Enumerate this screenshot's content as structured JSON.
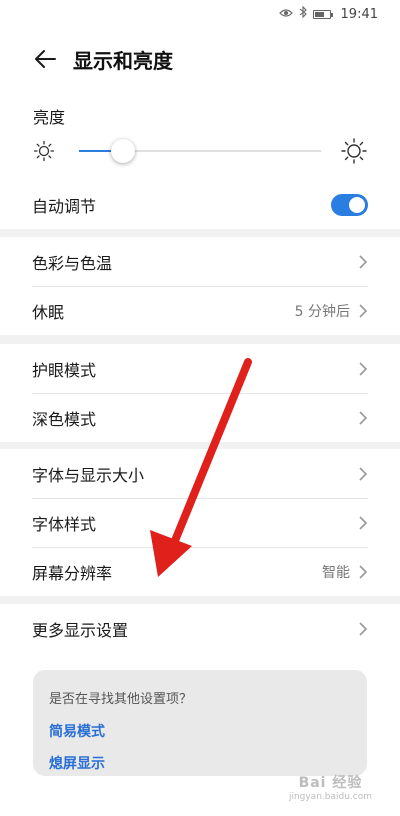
{
  "status_bar": {
    "time": "19:41"
  },
  "header": {
    "title": "显示和亮度"
  },
  "brightness": {
    "label": "亮度",
    "level": 0.18
  },
  "auto_adjust": {
    "label": "自动调节",
    "enabled": true
  },
  "group1": {
    "items": [
      {
        "label": "色彩与色温",
        "value": ""
      },
      {
        "label": "休眠",
        "value": "5 分钟后"
      }
    ]
  },
  "group2": {
    "items": [
      {
        "label": "护眼模式",
        "value": ""
      },
      {
        "label": "深色模式",
        "value": ""
      }
    ]
  },
  "group3": {
    "items": [
      {
        "label": "字体与显示大小",
        "value": ""
      },
      {
        "label": "字体样式",
        "value": ""
      },
      {
        "label": "屏幕分辨率",
        "value": "智能"
      }
    ]
  },
  "group4": {
    "items": [
      {
        "label": "更多显示设置",
        "value": ""
      }
    ]
  },
  "tip": {
    "title": "是否在寻找其他设置项？",
    "links": [
      "简易模式",
      "熄屏显示"
    ]
  },
  "watermark": {
    "brand": "Bai 经验",
    "site": "jingyan.baidu.com"
  },
  "colors": {
    "accent": "#2a7de1",
    "annotation_arrow": "#e0201b"
  }
}
